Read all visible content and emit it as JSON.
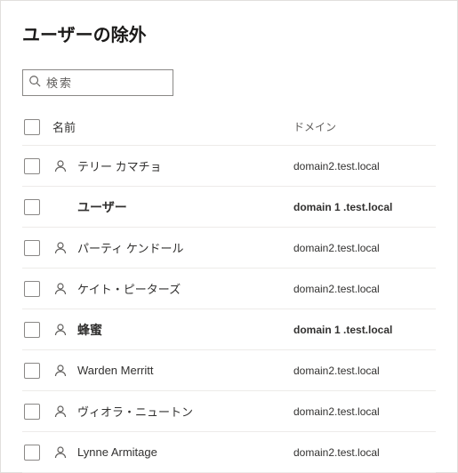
{
  "title": "ユーザーの除外",
  "search": {
    "placeholder": "検索"
  },
  "columns": {
    "name": "名前",
    "domain": "ドメイン"
  },
  "rows": [
    {
      "name": "テリー カマチョ",
      "domain": "domain2.test.local",
      "icon": true,
      "bold": false
    },
    {
      "name": "ユーザー",
      "domain": "domain 1 .test.local",
      "icon": false,
      "bold": true
    },
    {
      "name": "パーティ ケンドール",
      "domain": "domain2.test.local",
      "icon": true,
      "bold": false
    },
    {
      "name": "ケイト・ピーターズ",
      "domain": "domain2.test.local",
      "icon": true,
      "bold": false
    },
    {
      "name": "蜂蜜",
      "domain": "domain 1 .test.local",
      "icon": true,
      "bold": true
    },
    {
      "name": "Warden Merritt",
      "domain": "domain2.test.local",
      "icon": true,
      "bold": false
    },
    {
      "name": "ヴィオラ・ニュートン",
      "domain": "domain2.test.local",
      "icon": true,
      "bold": false
    },
    {
      "name": "Lynne Armitage",
      "domain": "domain2.test.local",
      "icon": true,
      "bold": false
    }
  ]
}
